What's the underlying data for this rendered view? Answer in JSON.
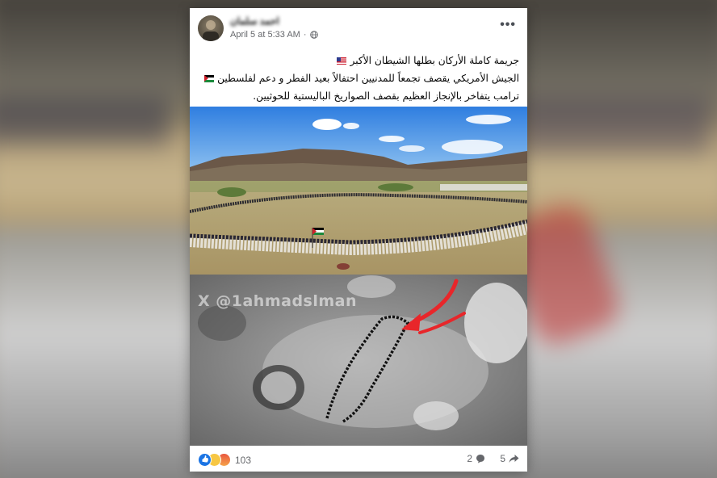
{
  "post": {
    "author": "احمد سلمان",
    "timestamp": "April 5 at 5:33 AM",
    "menu_label": "•••",
    "text_lines": [
      "جريمة كاملة الأركان بطلها الشيطان الأكبر",
      "الجيش الأمريكي يقصف تجمعاً للمدنيين احتفالاً بعيد الفطر و دعم لفلسطين",
      "ترامب يتفاخر بالإنجاز العظيم بقصف الصواريخ الباليستية للحوثيين."
    ],
    "watermark": "X @1ahmadslman",
    "reactions_count": "103",
    "comments_count": "2",
    "shares_count": "5"
  },
  "icons": {
    "privacy": "globe-icon",
    "reactions": [
      "like-icon",
      "sad-icon",
      "angry-icon"
    ],
    "comment": "comment-bubble-icon",
    "share": "share-arrow-icon",
    "menu": "more-options-icon"
  },
  "colors": {
    "arrow": "#e8262a",
    "link_blue": "#1b74e4",
    "meta_gray": "#65676b"
  }
}
